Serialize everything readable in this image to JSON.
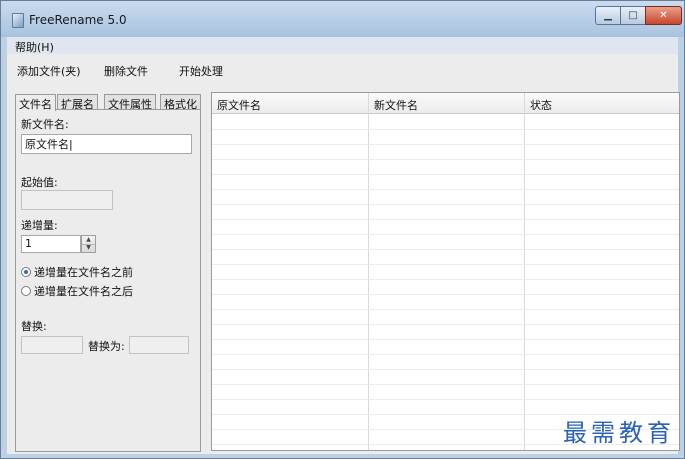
{
  "window": {
    "title": "FreeRename 5.0"
  },
  "menu": {
    "help": "帮助(H)"
  },
  "toolbar": {
    "add_files": "添加文件(夹)",
    "delete_files": "删除文件",
    "start": "开始处理"
  },
  "tabs": [
    {
      "label": "文件名"
    },
    {
      "label": "扩展名"
    },
    {
      "label": "文件属性"
    },
    {
      "label": "格式化"
    }
  ],
  "panel": {
    "new_name_label": "新文件名:",
    "new_name_value": "原文件名|",
    "start_value_label": "起始值:",
    "start_value": "",
    "increment_label": "递增量:",
    "increment_value": "1",
    "radio_before": "递增量在文件名之前",
    "radio_after": "递增量在文件名之后",
    "replace_label": "替换:",
    "replace_with_label": "替换为:"
  },
  "table": {
    "columns": [
      "原文件名",
      "新文件名",
      "状态"
    ]
  },
  "watermark": "最需教育"
}
